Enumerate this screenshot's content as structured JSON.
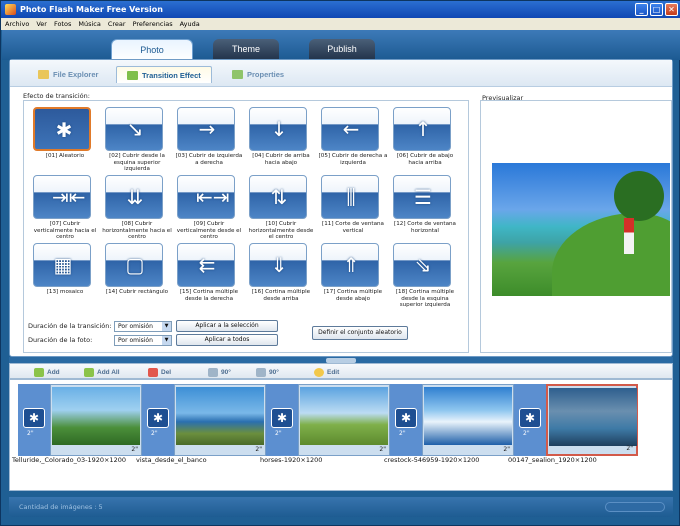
{
  "window": {
    "title": "Photo Flash Maker Free Version"
  },
  "menu": [
    "Archivo",
    "Ver",
    "Fotos",
    "Música",
    "Crear",
    "Preferencias",
    "Ayuda"
  ],
  "main_tabs": [
    {
      "label": "Photo",
      "active": true
    },
    {
      "label": "Theme",
      "active": false
    },
    {
      "label": "Publish",
      "active": false
    }
  ],
  "sub_tabs": [
    {
      "label": "File Explorer",
      "active": false
    },
    {
      "label": "Transition Effect",
      "active": true
    },
    {
      "label": "Properties",
      "active": false
    }
  ],
  "transitions": {
    "group_label": "Efecto de transición:",
    "items": [
      {
        "label": "[01] Aleatorio",
        "glyph": "✱",
        "selected": true
      },
      {
        "label": "[02] Cubrir desde la esquina superior izquierda",
        "glyph": "↘"
      },
      {
        "label": "[03] Cubrir de izquierda a derecha",
        "glyph": "→"
      },
      {
        "label": "[04] Cubrir de arriba hacia abajo",
        "glyph": "↓"
      },
      {
        "label": "[05] Cubrir de derecha a izquierda",
        "glyph": "←"
      },
      {
        "label": "[06] Cubrir de abajo hacia arriba",
        "glyph": "↑"
      },
      {
        "label": "[07] Cubrir verticalmente hacia el centro",
        "glyph": "⇥⇤"
      },
      {
        "label": "[08] Cubrir horizontalmente hacia el centro",
        "glyph": "⇊"
      },
      {
        "label": "[09] Cubrir verticalmente desde el centro",
        "glyph": "⇤⇥"
      },
      {
        "label": "[10] Cubrir horizontalmente desde el centro",
        "glyph": "⇅"
      },
      {
        "label": "[11] Corte de ventana vertical",
        "glyph": "⫼"
      },
      {
        "label": "[12] Corte de ventana horizontal",
        "glyph": "☰"
      },
      {
        "label": "[13] mosaico",
        "glyph": "▦"
      },
      {
        "label": "[14] Cubrir rectángulo",
        "glyph": "▢"
      },
      {
        "label": "[15] Cortina múltiple desde la derecha",
        "glyph": "⇇"
      },
      {
        "label": "[16] Cortina múltiple desde arriba",
        "glyph": "⇓"
      },
      {
        "label": "[17] Cortina múltiple desde abajo",
        "glyph": "⇑"
      },
      {
        "label": "[18] Cortina múltiple desde la esquina superior izquierda",
        "glyph": "⇘"
      }
    ]
  },
  "settings": {
    "transition_duration_label": "Duración de la transición:",
    "photo_duration_label": "Duración de la foto:",
    "transition_duration_value": "Por omisión",
    "photo_duration_value": "Por omisión",
    "apply_selection_label": "Aplicar a la selección",
    "apply_all_label": "Aplicar a todos",
    "random_set_label": "Definir el conjunto aleatorio"
  },
  "preview": {
    "label": "Previsualizar"
  },
  "toolbar": {
    "add": "Add",
    "add_all": "Add All",
    "del": "Del",
    "rotate_left": "90°",
    "rotate_right": "90°",
    "edit": "Edit"
  },
  "photos": [
    {
      "name": "Telluride,_Colorado_03-1920×1200",
      "duration": "2\"",
      "trans_duration": "2\""
    },
    {
      "name": "vista_desde_el_banco",
      "duration": "2\"",
      "trans_duration": "2\""
    },
    {
      "name": "horses-1920×1200",
      "duration": "2\"",
      "trans_duration": "2\""
    },
    {
      "name": "crestock-546959-1920×1200",
      "duration": "2\"",
      "trans_duration": "2\""
    },
    {
      "name": "00147_sealion_1920×1200",
      "duration": "2\"",
      "trans_duration": "2\"",
      "selected": true
    }
  ],
  "status": {
    "text": "Cantidad de imágenes : 5"
  }
}
